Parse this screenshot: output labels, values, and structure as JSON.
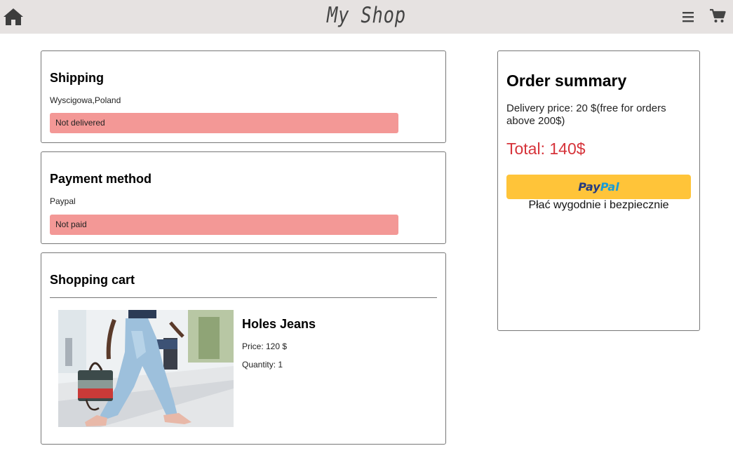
{
  "header": {
    "brand": "My Shop"
  },
  "shipping": {
    "title": "Shipping",
    "address": "Wyscigowa,Poland",
    "status": "Not delivered"
  },
  "payment": {
    "title": "Payment method",
    "method": "Paypal",
    "status": "Not paid"
  },
  "cart": {
    "title": "Shopping cart",
    "items": [
      {
        "name": "Holes Jeans",
        "price": "Price: 120 $",
        "quantity": "Quantity: 1"
      }
    ]
  },
  "summary": {
    "title": "Order summary",
    "delivery": "Delivery price: 20 $(free for orders above 200$)",
    "total": "Total: 140$",
    "paypal": {
      "logo_part1": "Pay",
      "logo_part2": "Pal",
      "tagline": "Płać wygodnie i bezpiecznie"
    }
  },
  "colors": {
    "header_bg": "#e6e2e1",
    "alert_bg": "#f39896",
    "total": "#d6333a",
    "paypal_button": "#ffc439"
  }
}
